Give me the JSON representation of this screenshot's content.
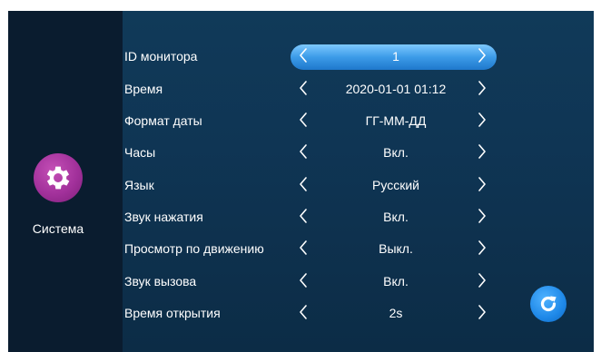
{
  "sidebar": {
    "icon": "gear-icon",
    "label": "Система",
    "icon_color": "#a2319b"
  },
  "settings": [
    {
      "label": "ID монитора",
      "value": "1",
      "selected": true
    },
    {
      "label": "Время",
      "value": "2020-01-01 01:12",
      "selected": false
    },
    {
      "label": "Формат даты",
      "value": "ГГ-ММ-ДД",
      "selected": false
    },
    {
      "label": "Часы",
      "value": "Вкл.",
      "selected": false
    },
    {
      "label": "Язык",
      "value": "Русский",
      "selected": false
    },
    {
      "label": "Звук нажатия",
      "value": "Вкл.",
      "selected": false
    },
    {
      "label": "Просмотр по движению",
      "value": "Выкл.",
      "selected": false
    },
    {
      "label": "Звук вызова",
      "value": "Вкл.",
      "selected": false
    },
    {
      "label": "Время открытия",
      "value": "2s",
      "selected": false
    }
  ],
  "controls": {
    "prev_icon": "chevron-left-icon",
    "next_icon": "chevron-right-icon",
    "refresh_icon": "refresh-icon",
    "accent": "#3c9be8"
  }
}
